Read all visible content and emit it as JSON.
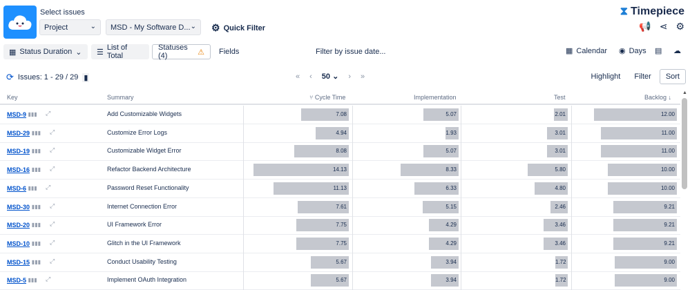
{
  "header": {
    "select_label": "Select issues",
    "project_select": "Project",
    "project_value": "MSD - My Software D...",
    "quick_filter": "Quick Filter",
    "brand": "Timepiece"
  },
  "toolbar": {
    "status_duration": "Status Duration",
    "list_of_total": "List of Total",
    "statuses": "Statuses (4)",
    "fields": "Fields",
    "filter_date": "Filter by issue date...",
    "calendar": "Calendar",
    "days": "Days"
  },
  "issues": {
    "range": "Issues: 1 - 29 / 29",
    "page_size": "50",
    "highlight": "Highlight",
    "filter": "Filter",
    "sort": "Sort"
  },
  "table": {
    "headers": {
      "key": "Key",
      "summary": "Summary",
      "cycle": "Cycle Time",
      "impl": "Implementation",
      "test": "Test",
      "backlog": "Backlog"
    },
    "max": {
      "cycle": 14.13,
      "impl": 8.33,
      "test": 5.8,
      "backlog": 12.0
    },
    "rows": [
      {
        "key": "MSD-9",
        "summary": "Add Customizable Widgets",
        "cycle": "7.08",
        "impl": "5.07",
        "test": "2.01",
        "backlog": "12.00"
      },
      {
        "key": "MSD-29",
        "summary": "Customize Error Logs",
        "cycle": "4.94",
        "impl": "1.93",
        "test": "3.01",
        "backlog": "11.00"
      },
      {
        "key": "MSD-19",
        "summary": "Customizable Widget Error",
        "cycle": "8.08",
        "impl": "5.07",
        "test": "3.01",
        "backlog": "11.00"
      },
      {
        "key": "MSD-16",
        "summary": "Refactor Backend Architecture",
        "cycle": "14.13",
        "impl": "8.33",
        "test": "5.80",
        "backlog": "10.00"
      },
      {
        "key": "MSD-6",
        "summary": "Password Reset Functionality",
        "cycle": "11.13",
        "impl": "6.33",
        "test": "4.80",
        "backlog": "10.00"
      },
      {
        "key": "MSD-30",
        "summary": "Internet Connection Error",
        "cycle": "7.61",
        "impl": "5.15",
        "test": "2.46",
        "backlog": "9.21"
      },
      {
        "key": "MSD-20",
        "summary": "UI Framework Error",
        "cycle": "7.75",
        "impl": "4.29",
        "test": "3.46",
        "backlog": "9.21"
      },
      {
        "key": "MSD-10",
        "summary": "Glitch in the UI Framework",
        "cycle": "7.75",
        "impl": "4.29",
        "test": "3.46",
        "backlog": "9.21"
      },
      {
        "key": "MSD-15",
        "summary": "Conduct Usability Testing",
        "cycle": "5.67",
        "impl": "3.94",
        "test": "1.72",
        "backlog": "9.00"
      },
      {
        "key": "MSD-5",
        "summary": "Implement OAuth Integration",
        "cycle": "5.67",
        "impl": "3.94",
        "test": "1.72",
        "backlog": "9.00"
      }
    ]
  }
}
